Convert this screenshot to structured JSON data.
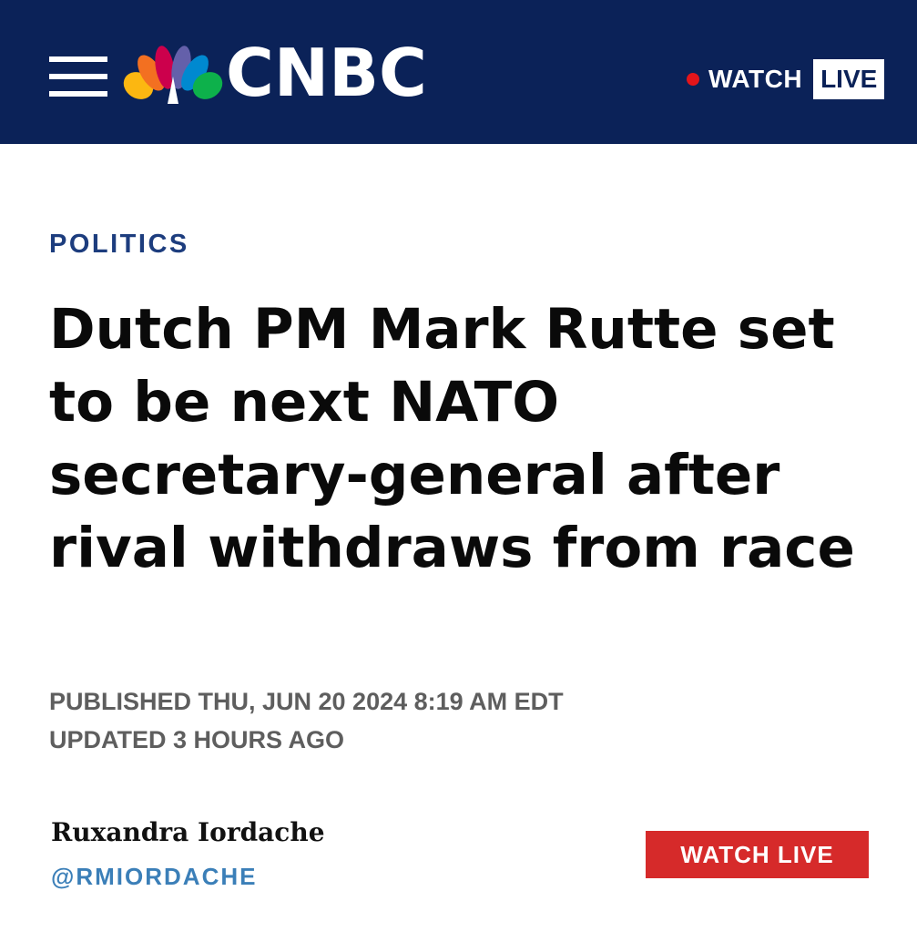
{
  "header": {
    "menu_icon": "hamburger-menu-icon",
    "logo_icon": "nbc-peacock-icon",
    "logo_text": "CNBC",
    "watch_label": "WATCH",
    "live_label": "LIVE",
    "live_dot_icon": "red-dot-icon",
    "colors": {
      "background": "#0b2258",
      "peacock": [
        "#fcb711",
        "#f37021",
        "#cc004c",
        "#6460aa",
        "#0089d0",
        "#0db14b"
      ]
    }
  },
  "article": {
    "section": "POLITICS",
    "headline": "Dutch PM Mark Rutte set to be next NATO secretary-general after rival withdraws from race",
    "published": "PUBLISHED THU, JUN 20 2024 8:19 AM EDT",
    "updated": "UPDATED 3 HOURS AGO",
    "author": {
      "name": "Ruxandra Iordache",
      "handle": "@RMIORDACHE"
    },
    "watch_live_button": "WATCH LIVE",
    "colors": {
      "section": "#1d3d7e",
      "handle": "#3b7fb8",
      "watch_live_button": "#d62a2a"
    }
  }
}
